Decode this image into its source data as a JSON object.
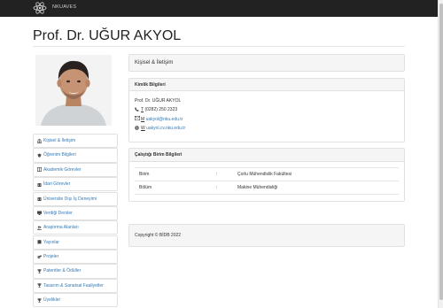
{
  "header": {
    "brand": "NKUAVES",
    "logo_icon": "atom-icon",
    "bar_color": "#222222"
  },
  "profile": {
    "title": "Prof. Dr. UĞUR AKYOL",
    "photo": "profile-photo"
  },
  "nav": {
    "items": [
      {
        "label": "Kişisel & İletişim",
        "icon": "bank-icon"
      },
      {
        "label": "Öğrenim Bilgileri",
        "icon": "graduation-cap-icon"
      },
      {
        "label": "Akademik Görevler",
        "icon": "columns-icon"
      },
      {
        "label": "İdari Görevler",
        "icon": "building-icon"
      },
      {
        "label": "Üniversite Dışı İş Deneyimi",
        "icon": "building-icon"
      },
      {
        "label": "Verdiği Dersler",
        "icon": "monitor-icon"
      },
      {
        "label": "Araştırma Alanları",
        "icon": "users-icon"
      },
      {
        "label": "Yayınlar",
        "icon": "book-icon"
      },
      {
        "label": "Projeler",
        "icon": "cogs-icon"
      },
      {
        "label": "Patentler & Ödüller",
        "icon": "trophy-icon"
      },
      {
        "label": "Tasarım & Sanatsal Faaliyetler",
        "icon": "trophy-icon"
      },
      {
        "label": "Üyelikler",
        "icon": "trophy-icon"
      }
    ]
  },
  "kisisel": {
    "heading": "Kişisel & İletişim"
  },
  "kimlik": {
    "heading": "Kimlik Bilgileri",
    "name": "Prof. Dr. UĞUR AKYOL",
    "phone_prefix": "T",
    "phone": "(0282) 250 2323",
    "email_prefix": "M",
    "email": "uakyol@nku.edu.tr",
    "web_prefix": "W",
    "web": "uakyol.cv.nku.edu.tr"
  },
  "calistigi": {
    "heading": "Çalıştığı Birim Bilgileri",
    "rows": [
      {
        "label": "Birim",
        "sep": ":",
        "value": "Çorlu Mühendislik Fakültesi"
      },
      {
        "label": "Bölüm",
        "sep": ":",
        "value": "Makine Mühendisliği"
      }
    ]
  },
  "footer": {
    "copyright": "Copyright © BİDB 2022"
  },
  "colors": {
    "link": "#337ab7",
    "panel_bg": "#f5f5f5"
  }
}
